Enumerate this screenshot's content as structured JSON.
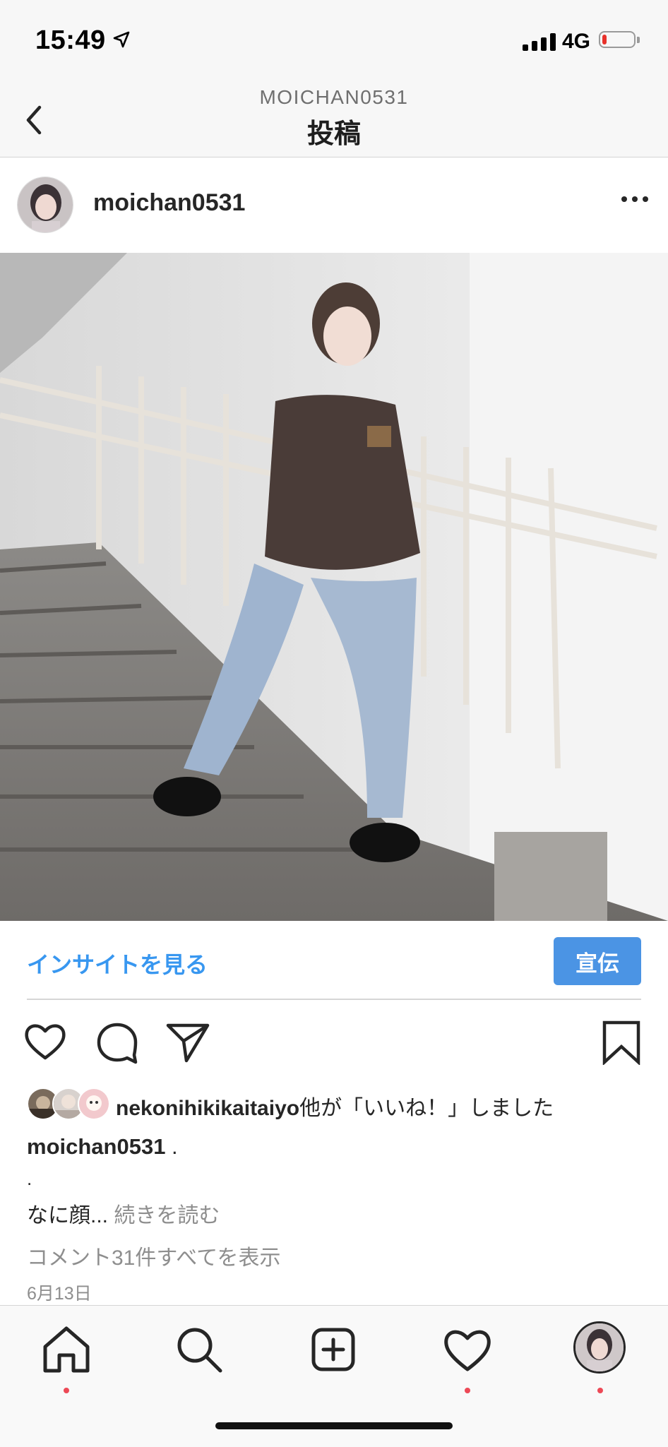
{
  "status": {
    "time": "15:49",
    "network": "4G",
    "battery_level": 0.15,
    "battery_color": "#e8322b"
  },
  "nav": {
    "subtitle": "MOICHAN0531",
    "title": "投稿"
  },
  "post": {
    "username": "moichan0531",
    "insight_label": "インサイトを見る",
    "promote_label": "宣伝",
    "likes": {
      "user": "nekonihikikaitaiyo",
      "suffix": "他が「いいね！」しました"
    },
    "caption": {
      "user": "moichan0531",
      "text": " .",
      "line2": ".",
      "line3": "なに顔...",
      "more": " 続きを読む"
    },
    "view_comments": "コメント31件すべてを表示",
    "date": "6月13日"
  },
  "icons": {
    "back": "chevron-left-icon",
    "more": "more-horizontal-icon",
    "like": "heart-icon",
    "comment": "comment-bubble-icon",
    "share": "paper-plane-icon",
    "save": "bookmark-icon",
    "home": "home-icon",
    "search": "search-icon",
    "new_post": "add-post-icon",
    "activity": "heart-icon",
    "profile": "profile-avatar-icon"
  },
  "colors": {
    "link": "#3897f0",
    "promote": "#4b94e4",
    "notification_dot": "#ed4956"
  }
}
